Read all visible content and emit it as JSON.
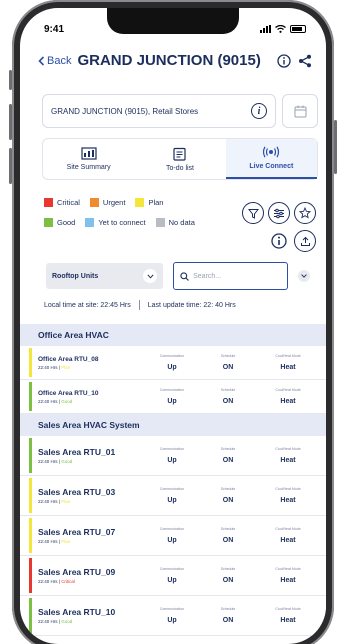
{
  "status": {
    "time": "9:41"
  },
  "header": {
    "back_label": "Back",
    "title": "GRAND JUNCTION (9015)"
  },
  "site": {
    "name": "GRAND JUNCTION (9015), Retail Stores"
  },
  "tabs": [
    {
      "label": "Site Summary",
      "active": false
    },
    {
      "label": "To-do list",
      "active": false
    },
    {
      "label": "Live Connect",
      "active": true
    }
  ],
  "legend": [
    {
      "label": "Critical",
      "color": "#e8372f"
    },
    {
      "label": "Urgent",
      "color": "#f08a2c"
    },
    {
      "label": "Plan",
      "color": "#f4e53b"
    },
    {
      "label": "Good",
      "color": "#7cbf42"
    },
    {
      "label": "Yet to connect",
      "color": "#7fc1ec"
    },
    {
      "label": "No data",
      "color": "#b9bcc4"
    }
  ],
  "filter": {
    "dropdown_label": "Rooftop Units",
    "search_placeholder": "Search..."
  },
  "times": {
    "local": "Local time at site: 22:45 Hrs",
    "update": "Last update time: 22: 40 Hrs"
  },
  "colors": {
    "accent": "#2d4ea6",
    "navy": "#1c2e5e",
    "group_bg": "#e4e9f5"
  },
  "column_labels": {
    "comm": "Communication",
    "sched": "Schedule",
    "mode": "Cool/Heat Mode"
  },
  "groups": [
    {
      "name": "Office Area HVAC",
      "units": [
        {
          "name": "Office Area RTU_08",
          "time": "22:40 Hrs",
          "status": "Plan",
          "status_color": "#f4e53b",
          "comm": "Up",
          "schedule": "ON",
          "mode": "Heat"
        },
        {
          "name": "Office Area RTU_10",
          "time": "22:40 Hrs",
          "status": "Good",
          "status_color": "#7cbf42",
          "comm": "Up",
          "schedule": "ON",
          "mode": "Heat"
        }
      ]
    },
    {
      "name": "Sales Area HVAC System",
      "units": [
        {
          "name": "Sales Area RTU_01",
          "time": "22:40 Hrs",
          "status": "Good",
          "status_color": "#7cbf42",
          "comm": "Up",
          "schedule": "ON",
          "mode": "Heat"
        },
        {
          "name": "Sales Area RTU_03",
          "time": "22:40 Hrs",
          "status": "Plan",
          "status_color": "#f4e53b",
          "comm": "Up",
          "schedule": "ON",
          "mode": "Heat"
        },
        {
          "name": "Sales Area RTU_07",
          "time": "22:40 Hrs",
          "status": "Plan",
          "status_color": "#f4e53b",
          "comm": "Up",
          "schedule": "ON",
          "mode": "Heat"
        },
        {
          "name": "Sales Area RTU_09",
          "time": "22:40 Hrs",
          "status": "Critical",
          "status_color": "#e8372f",
          "comm": "Up",
          "schedule": "ON",
          "mode": "Heat"
        },
        {
          "name": "Sales Area RTU_10",
          "time": "22:40 Hrs",
          "status": "Good",
          "status_color": "#7cbf42",
          "comm": "Up",
          "schedule": "ON",
          "mode": "Heat"
        }
      ]
    }
  ]
}
